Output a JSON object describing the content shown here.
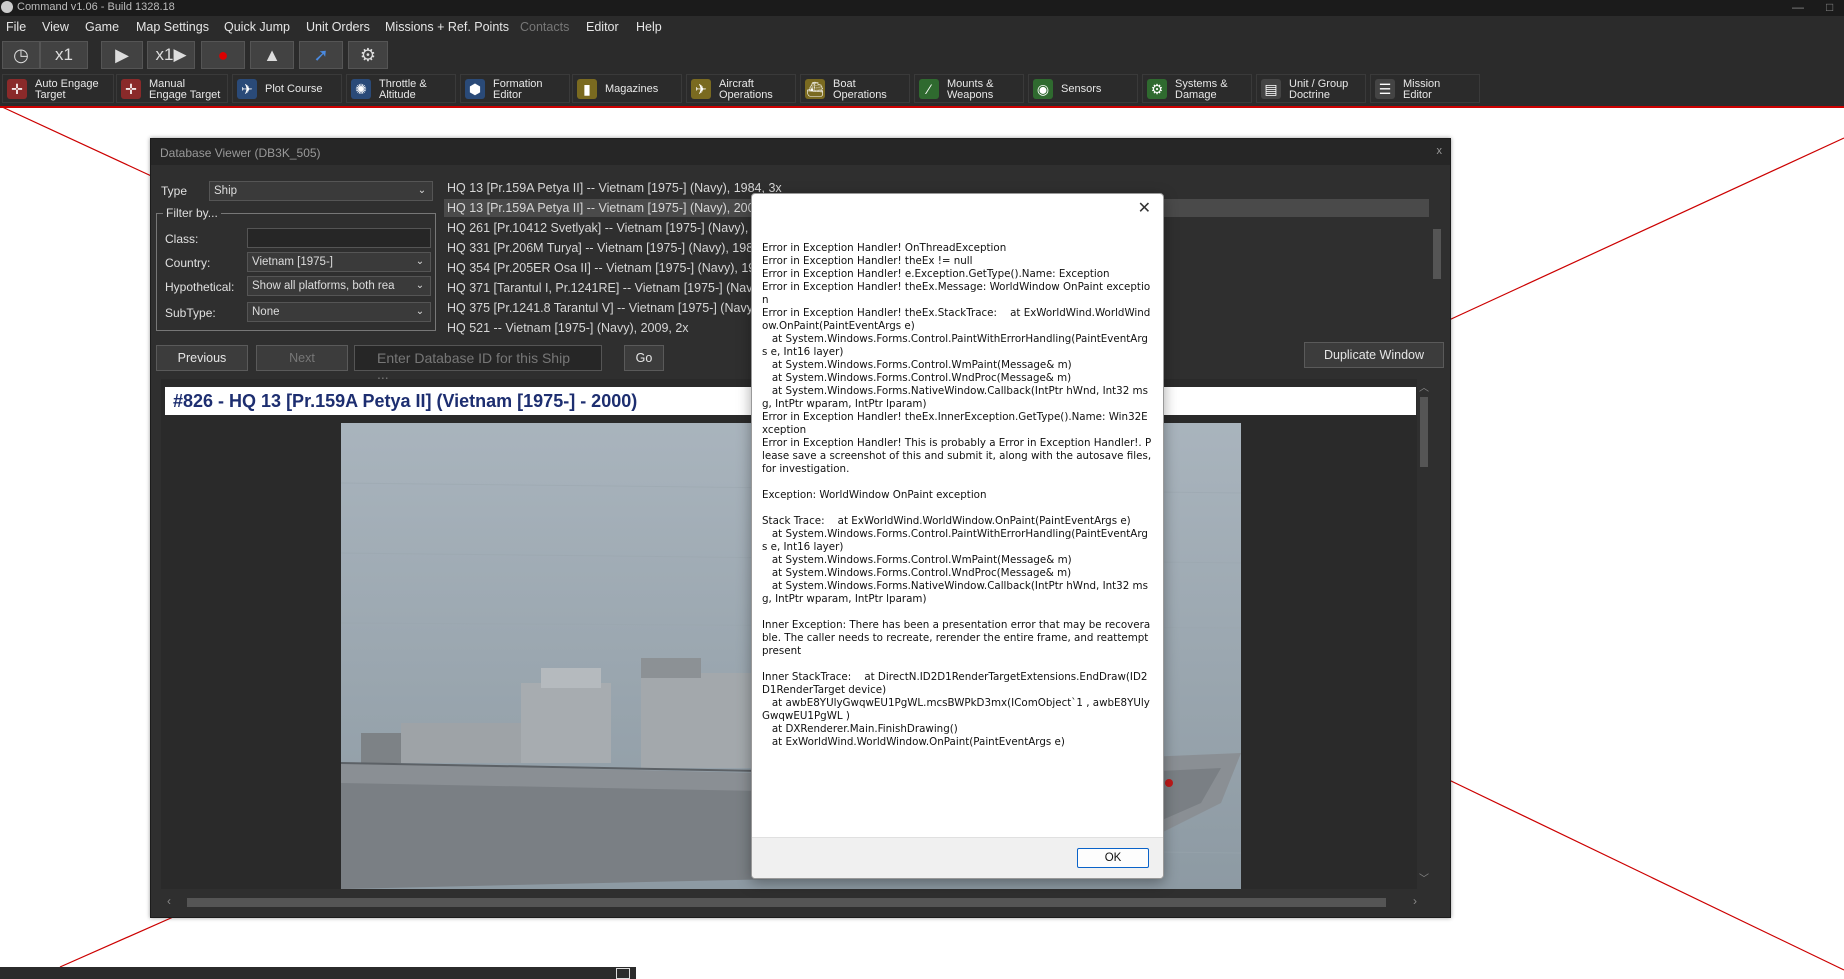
{
  "app": {
    "title": "Command v1.06 - Build 1328.18"
  },
  "menu": [
    "File",
    "View",
    "Game",
    "Map Settings",
    "Quick Jump",
    "Unit Orders",
    "Missions + Ref. Points",
    "Contacts",
    "Editor",
    "Help"
  ],
  "sim_controls": {
    "clock_speed": "x1",
    "compression": "x1"
  },
  "function_buttons": [
    {
      "label": "Auto Engage\nTarget",
      "color": "#8a2a2a",
      "icon": "crosshair-icon"
    },
    {
      "label": "Manual\nEngage Target",
      "color": "#8a2a2a",
      "icon": "crosshair-icon"
    },
    {
      "label": "Plot Course",
      "color": "#2a4a78",
      "icon": "course-icon"
    },
    {
      "label": "Throttle &\nAltitude",
      "color": "#2a4a78",
      "icon": "throttle-icon"
    },
    {
      "label": "Formation\nEditor",
      "color": "#2a4a78",
      "icon": "formation-icon"
    },
    {
      "label": "Magazines",
      "color": "#7a6a20",
      "icon": "magazine-icon"
    },
    {
      "label": "Aircraft\nOperations",
      "color": "#7a6a20",
      "icon": "aircraft-icon"
    },
    {
      "label": "Boat\nOperations",
      "color": "#7a6a20",
      "icon": "boat-icon"
    },
    {
      "label": "Mounts &\nWeapons",
      "color": "#2f6a2f",
      "icon": "weapons-icon"
    },
    {
      "label": "Sensors",
      "color": "#2f6a2f",
      "icon": "sensor-icon"
    },
    {
      "label": "Systems &\nDamage",
      "color": "#2f6a2f",
      "icon": "gear-icon"
    },
    {
      "label": "Unit / Group\nDoctrine",
      "color": "#444444",
      "icon": "doctrine-icon"
    },
    {
      "label": "Mission\nEditor",
      "color": "#444444",
      "icon": "mission-icon"
    }
  ],
  "db_viewer": {
    "title": "Database Viewer (DB3K_505)",
    "close": "x",
    "type_label": "Type",
    "type_value": "Ship",
    "filter_label": "Filter by...",
    "class_label": "Class:",
    "class_value": "",
    "country_label": "Country:",
    "country_value": "Vietnam [1975-]",
    "hypothetical_label": "Hypothetical:",
    "hypothetical_value": "Show all platforms, both rea",
    "subtype_label": "SubType:",
    "subtype_value": "None",
    "platforms": [
      "HQ 13 [Pr.159A Petya II] -- Vietnam [1975-] (Navy), 1984, 3x",
      "HQ 13 [Pr.159A Petya II] -- Vietnam [1975-] (Navy), 2000",
      "HQ 261 [Pr.10412 Svetlyak] -- Vietnam [1975-] (Navy), 20",
      "HQ 331 [Pr.206M Turya] -- Vietnam [1975-] (Navy), 1984",
      "HQ 354 [Pr.205ER Osa II] -- Vietnam [1975-] (Navy), 1980",
      "HQ 371 [Tarantul I, Pr.1241RE] -- Vietnam [1975-] (Navy)",
      "HQ 375 [Pr.1241.8 Tarantul V] -- Vietnam [1975-] (Navy),",
      "HQ 521 -- Vietnam [1975-] (Navy), 2009, 2x"
    ],
    "selected_index": 1,
    "previous_label": "Previous",
    "next_label": "Next",
    "id_placeholder": "Enter Database ID for this Ship ...",
    "go_label": "Go",
    "duplicate_label": "Duplicate Window",
    "heading": "#826 - HQ 13 [Pr.159A Petya II] (Vietnam [1975-] - 2000)"
  },
  "error_dialog": {
    "close": "✕",
    "message": "Error in Exception Handler! OnThreadException\nError in Exception Handler! theEx != null\nError in Exception Handler! e.Exception.GetType().Name: Exception\nError in Exception Handler! theEx.Message: WorldWindow OnPaint exception\nError in Exception Handler! theEx.StackTrace:    at ExWorldWind.WorldWindow.OnPaint(PaintEventArgs e)\n   at System.Windows.Forms.Control.PaintWithErrorHandling(PaintEventArgs e, Int16 layer)\n   at System.Windows.Forms.Control.WmPaint(Message& m)\n   at System.Windows.Forms.Control.WndProc(Message& m)\n   at System.Windows.Forms.NativeWindow.Callback(IntPtr hWnd, Int32 msg, IntPtr wparam, IntPtr lparam)\nError in Exception Handler! theEx.InnerException.GetType().Name: Win32Exception\nError in Exception Handler! This is probably a Error in Exception Handler!. Please save a screenshot of this and submit it, along with the autosave files, for investigation.\n\nException: WorldWindow OnPaint exception\n\nStack Trace:    at ExWorldWind.WorldWindow.OnPaint(PaintEventArgs e)\n   at System.Windows.Forms.Control.PaintWithErrorHandling(PaintEventArgs e, Int16 layer)\n   at System.Windows.Forms.Control.WmPaint(Message& m)\n   at System.Windows.Forms.Control.WndProc(Message& m)\n   at System.Windows.Forms.NativeWindow.Callback(IntPtr hWnd, Int32 msg, IntPtr wparam, IntPtr lparam)\n\nInner Exception: There has been a presentation error that may be recoverable. The caller needs to recreate, rerender the entire frame, and reattempt present\n\nInner StackTrace:    at DirectN.ID2D1RenderTargetExtensions.EndDraw(ID2D1RenderTarget device)\n   at awbE8YUlyGwqwEU1PgWL.mcsBWPkD3mx(IComObject`1 , awbE8YUlyGwqwEU1PgWL )\n   at DXRenderer.Main.FinishDrawing()\n   at ExWorldWind.WorldWindow.OnPaint(PaintEventArgs e)",
    "ok_label": "OK"
  },
  "colors": {
    "chrome": "#2b2b2b",
    "accent_line": "#cc0000",
    "heading_text": "#1d2e70"
  }
}
